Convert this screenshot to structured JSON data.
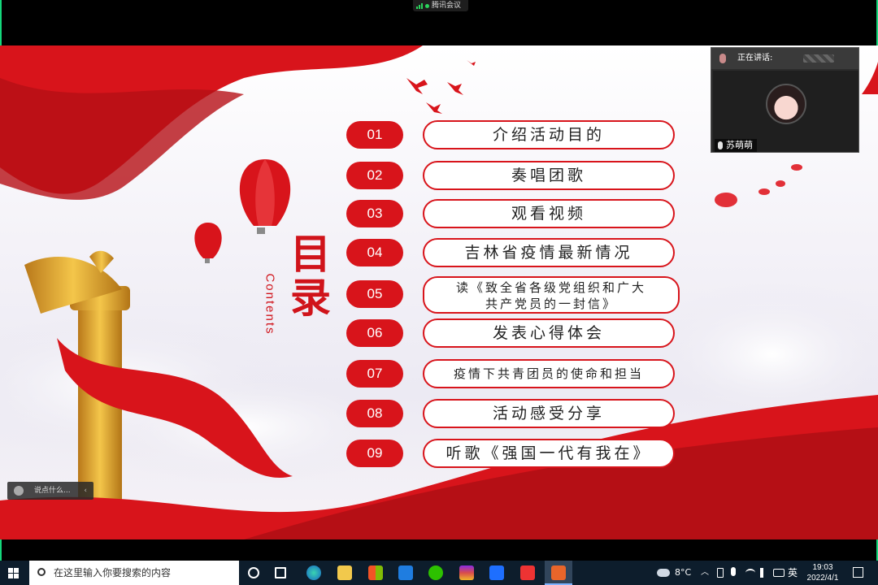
{
  "meeting": {
    "app_title": "腾讯会议",
    "accent": "#2bd45c"
  },
  "slide": {
    "title": "目录",
    "subtitle": "Contents",
    "theme_color": "#d8141b",
    "items": [
      {
        "num": "01",
        "label": "介绍活动目的"
      },
      {
        "num": "02",
        "label": "奏唱团歌"
      },
      {
        "num": "03",
        "label": "观看视频"
      },
      {
        "num": "04",
        "label": "吉林省疫情最新情况"
      },
      {
        "num": "05",
        "label_line1": "读《致全省各级党组织和广大",
        "label_line2": "共产党员的一封信》"
      },
      {
        "num": "06",
        "label": "发表心得体会"
      },
      {
        "num": "07",
        "label": "疫情下共青团员的使命和担当"
      },
      {
        "num": "08",
        "label": "活动感受分享"
      },
      {
        "num": "09",
        "label": "听歌《强国一代有我在》"
      }
    ]
  },
  "speaker_panel": {
    "status_label": "正在讲话:",
    "name": "苏萌萌"
  },
  "chat": {
    "placeholder": "说点什么...",
    "collapse_glyph": "‹"
  },
  "taskbar": {
    "search_placeholder": "在这里输入你要搜索的内容",
    "weather": "8°C",
    "ime": "英",
    "time": "19:03",
    "date": "2022/4/1",
    "icons": [
      "task-view-icon",
      "edge-icon",
      "file-explorer-icon",
      "store-icon",
      "mail-icon",
      "wechat-icon",
      "winrar-icon",
      "feishu-icon",
      "wps-icon",
      "wps-presentation-icon"
    ]
  }
}
